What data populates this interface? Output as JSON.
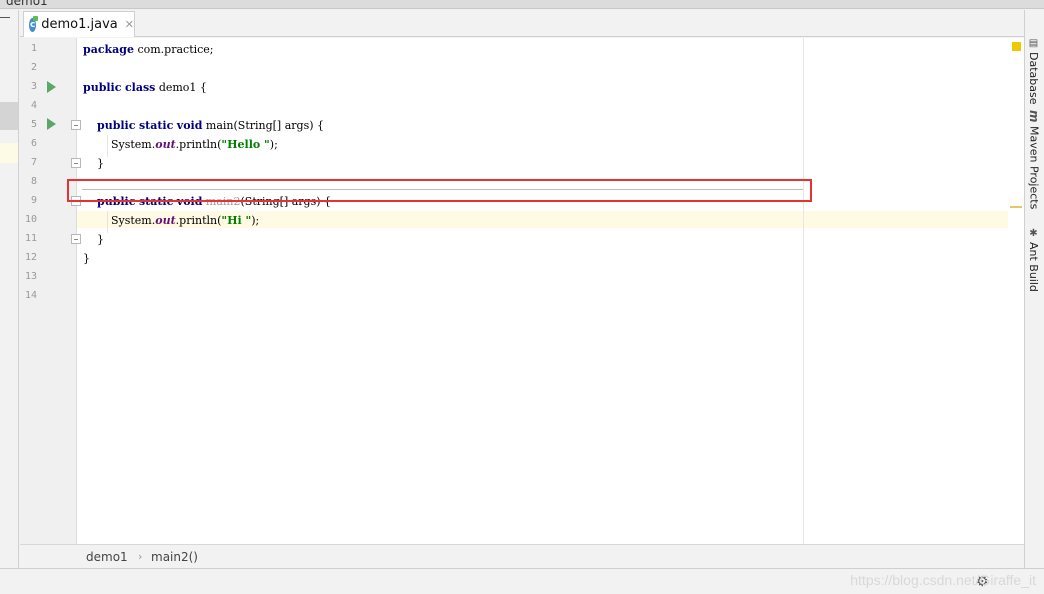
{
  "window": {
    "project_crumb": "demo1"
  },
  "tabs": [
    {
      "icon": "java-class-icon",
      "icon_letter": "c",
      "label": "demo1.java",
      "close": "✕"
    }
  ],
  "code_lines": [
    {
      "n": "1",
      "text": "package com.practice;"
    },
    {
      "n": "2",
      "text": ""
    },
    {
      "n": "3",
      "text": "public class demo1 {"
    },
    {
      "n": "4",
      "text": ""
    },
    {
      "n": "5",
      "text": "    public static void main(String[] args) {"
    },
    {
      "n": "6",
      "text": "        System.out.println(\"Hello \");"
    },
    {
      "n": "7",
      "text": "    }"
    },
    {
      "n": "8",
      "text": ""
    },
    {
      "n": "9",
      "text": "    public static void main2(String[] args) {"
    },
    {
      "n": "10",
      "text": "        System.out.println(\"Hi \");"
    },
    {
      "n": "11",
      "text": "    }"
    },
    {
      "n": "12",
      "text": "}"
    },
    {
      "n": "13",
      "text": ""
    },
    {
      "n": "14",
      "text": ""
    }
  ],
  "tokens": {
    "package": "package",
    "public": "public",
    "class": "class",
    "static": "static",
    "void": "void",
    "pkg_name": " com.practice;",
    "class_name": " demo1 {",
    "main_sig": " main(String[] args) {",
    "main2_name": " main2",
    "main2_args": "(String[] args) {",
    "system": "System.",
    "out": "out",
    "println": ".println(",
    "hello": "\"Hello \"",
    "hi": "\"Hi \"",
    "close_call": ");",
    "rbrace": "}"
  },
  "breadcrumbs": {
    "file": "demo1",
    "separator": "›",
    "method": "main2()"
  },
  "right_tools": [
    {
      "label": "Database",
      "icon": "database-icon",
      "glyph": "▤"
    },
    {
      "label": "Maven Projects",
      "icon": "maven-icon",
      "glyph": "m"
    },
    {
      "label": "Ant Build",
      "icon": "ant-icon",
      "glyph": "✱"
    }
  ],
  "status": {
    "watermark": "https://blog.csdn.net/Giraffe_it",
    "gear_glyph": "⚙"
  },
  "colors": {
    "keyword": "#000080",
    "string": "#008000",
    "field": "#660e7a",
    "highlight_box": "#e53333",
    "run_icon": "#59a869"
  }
}
